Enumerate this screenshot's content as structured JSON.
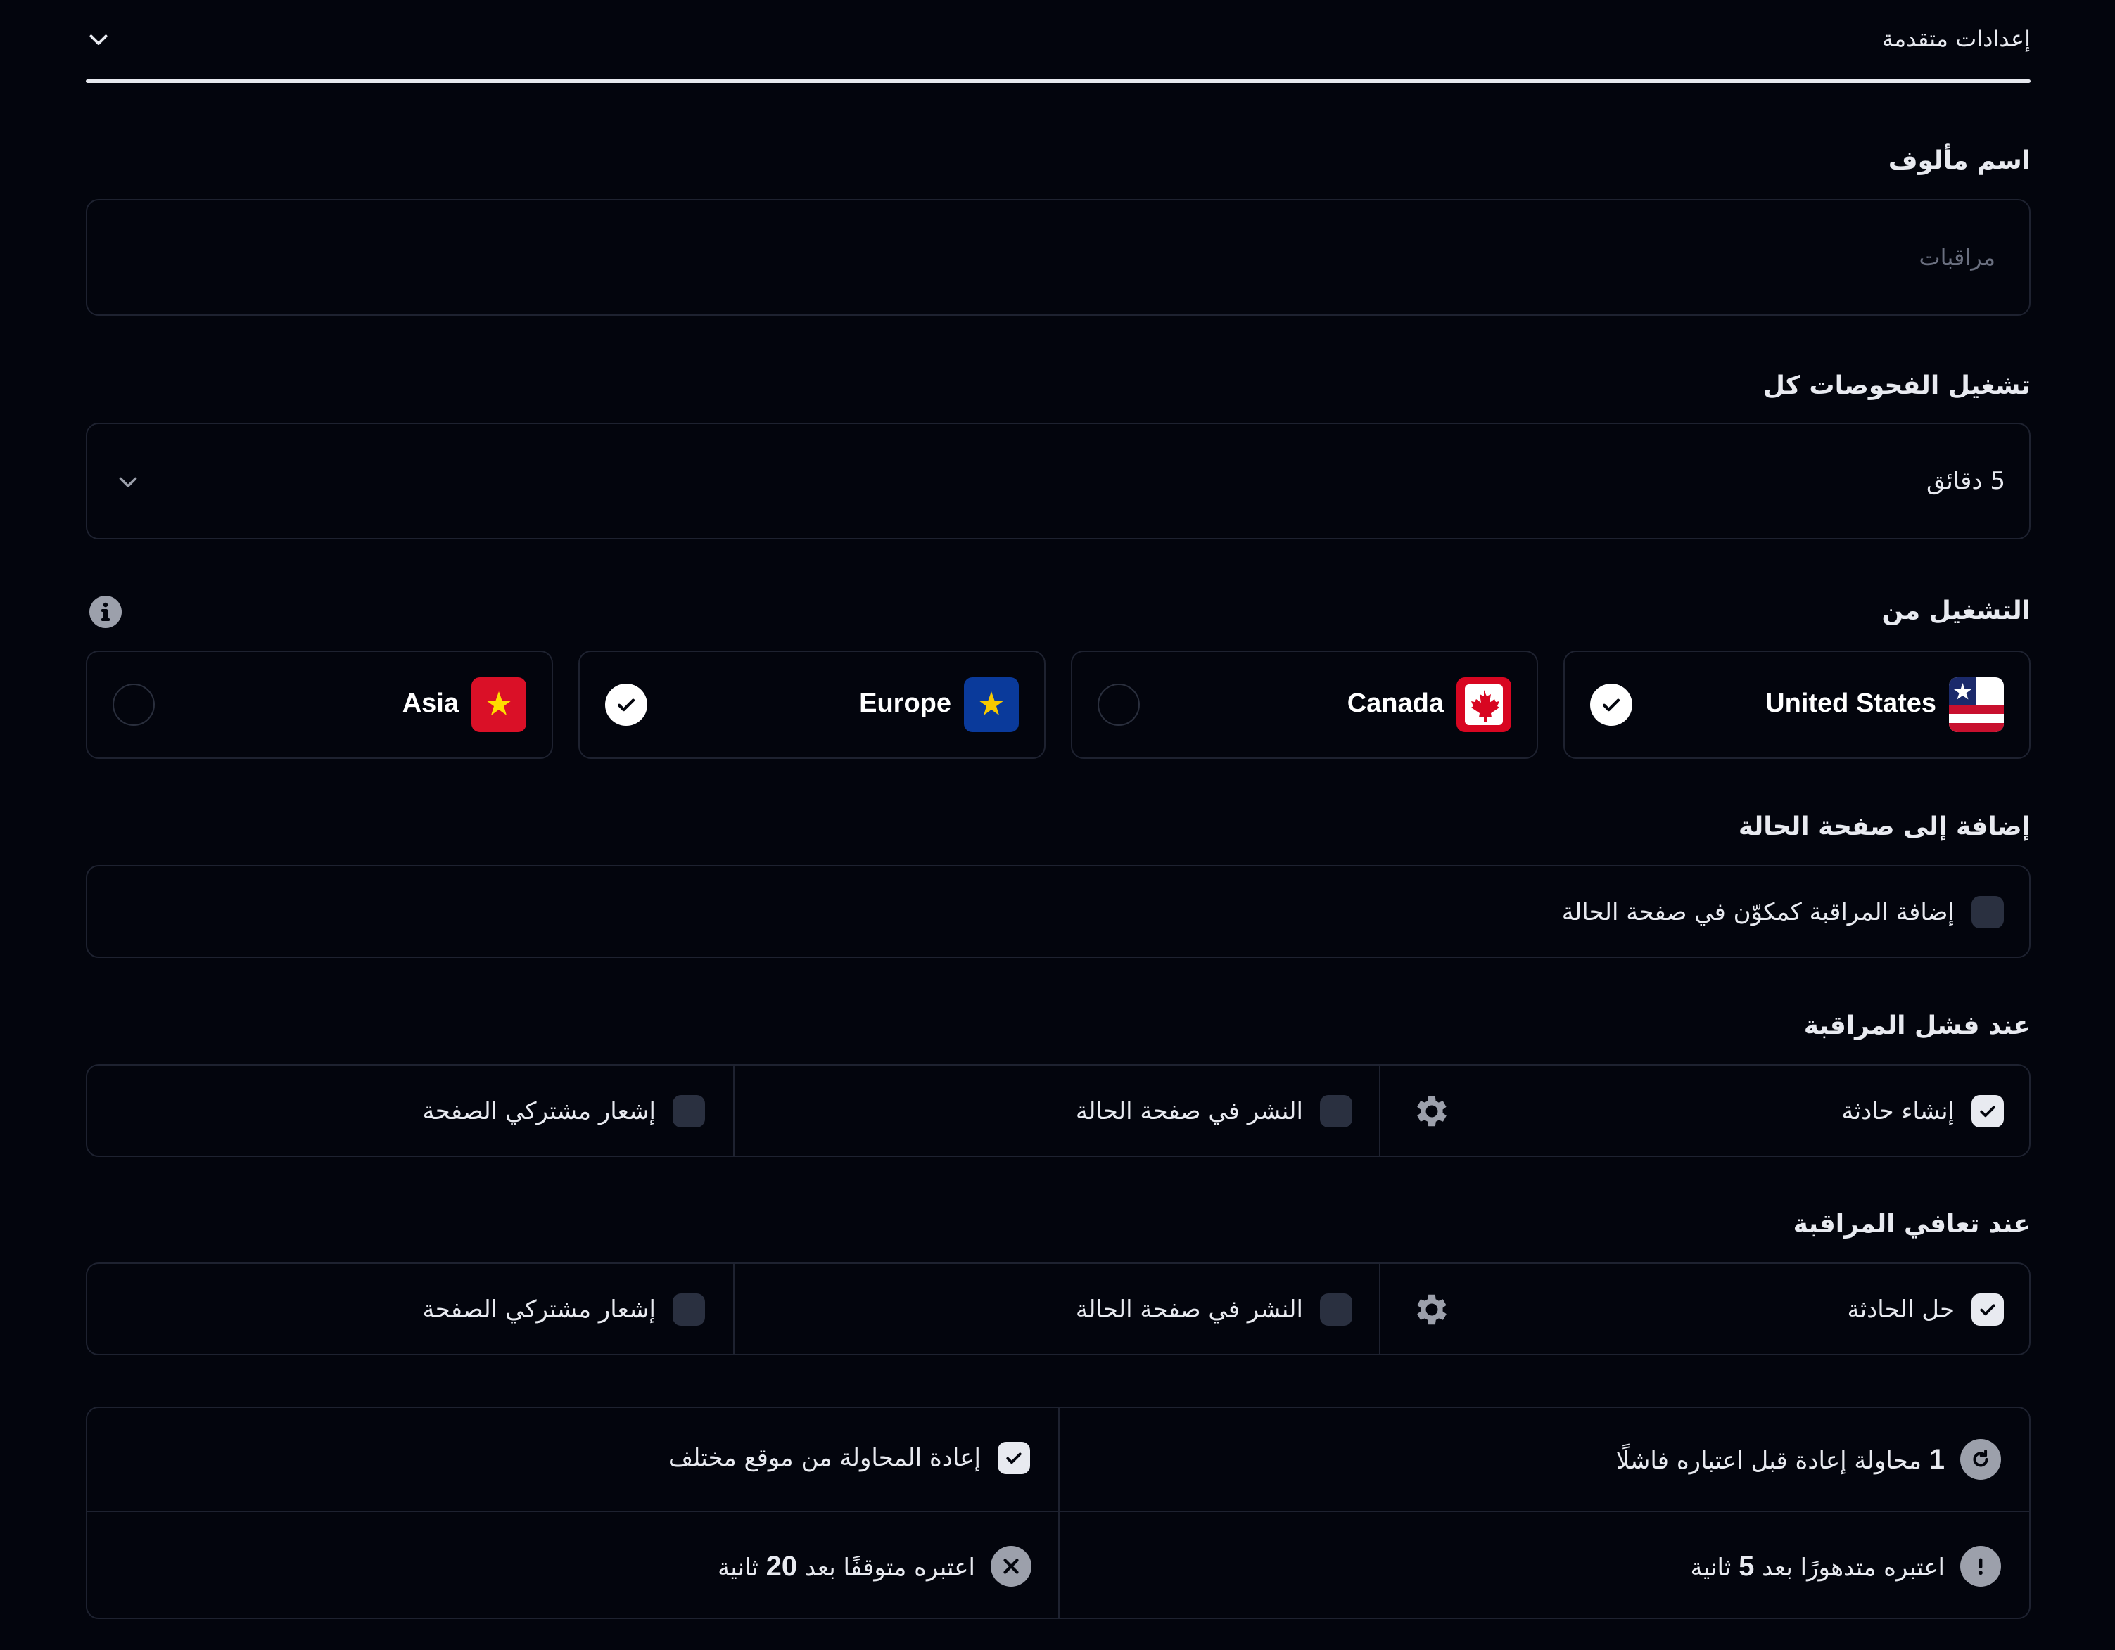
{
  "header": {
    "title": "إعدادات متقدمة"
  },
  "friendly_name": {
    "label": "اسم مألوف",
    "placeholder": "مراقبات"
  },
  "check_interval": {
    "label": "تشغيل الفحوصات كل",
    "value": "5 دقائق"
  },
  "run_from": {
    "label": "التشغيل من",
    "regions": [
      {
        "name": "United States",
        "selected": true
      },
      {
        "name": "Canada",
        "selected": false
      },
      {
        "name": "Europe",
        "selected": true
      },
      {
        "name": "Asia",
        "selected": false
      }
    ]
  },
  "status_page": {
    "label": "إضافة إلى صفحة الحالة",
    "option": "إضافة المراقبة كمكوّن في صفحة الحالة",
    "checked": false
  },
  "on_failure": {
    "label": "عند فشل المراقبة",
    "options": [
      {
        "text": "إنشاء حادثة",
        "checked": true
      },
      {
        "text": "النشر في صفحة الحالة",
        "checked": false
      },
      {
        "text": "إشعار مشتركي الصفحة",
        "checked": false
      }
    ]
  },
  "on_recovery": {
    "label": "عند تعافي المراقبة",
    "options": [
      {
        "text": "حل الحادثة",
        "checked": true
      },
      {
        "text": "النشر في صفحة الحالة",
        "checked": false
      },
      {
        "text": "إشعار مشتركي الصفحة",
        "checked": false
      }
    ]
  },
  "retry_settings": {
    "retries_count": "1",
    "retries_text": "محاولة إعادة قبل اعتباره فاشلًا",
    "retry_other_location": "إعادة المحاولة من موقع مختلف",
    "degraded_prefix": "اعتبره متدهورًا بعد",
    "degraded_value": "5",
    "degraded_unit": "ثانية",
    "down_prefix": "اعتبره متوقفًا بعد",
    "down_value": "20",
    "down_unit": "ثانية"
  },
  "colors": {
    "background": "#03050d",
    "border": "#1e2230",
    "checkbox": "#2a3040",
    "accent": "#ffffff"
  }
}
